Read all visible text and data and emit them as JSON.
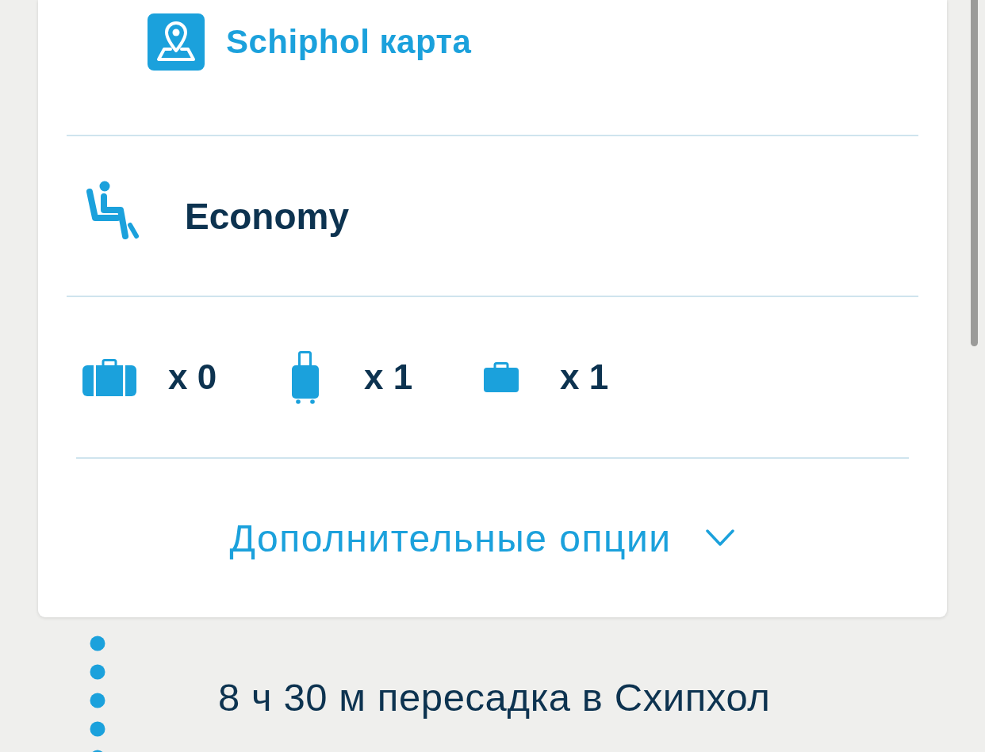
{
  "map_link": {
    "label": "Schiphol карта"
  },
  "cabin_class": {
    "label": "Economy"
  },
  "baggage": [
    {
      "kind": "suitcase",
      "count": "x 0"
    },
    {
      "kind": "trolley",
      "count": "x 1"
    },
    {
      "kind": "briefcase",
      "count": "x 1"
    }
  ],
  "more_options": {
    "label": "Дополнительные опции",
    "expanded": false
  },
  "layover": {
    "text": "8 ч 30 м пересадка в Схипхол"
  }
}
